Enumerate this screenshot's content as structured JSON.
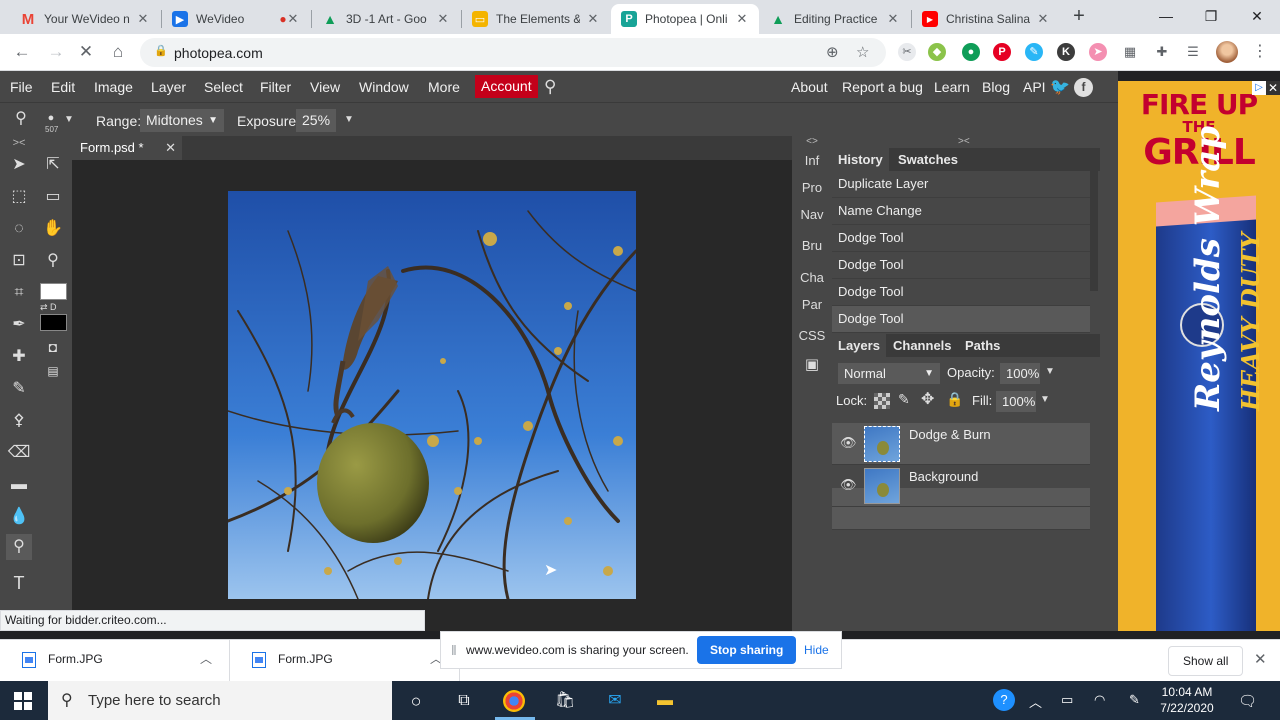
{
  "browser": {
    "tabs": [
      {
        "title": "Your WeVideo n",
        "icon": "gmail-icon",
        "color": "#ea4335"
      },
      {
        "title": "WeVideo",
        "icon": "wevideo-icon",
        "color": "#1a73e8"
      },
      {
        "title": "3D -1 Art - Goo",
        "icon": "drive-icon",
        "color": "#0f9d58"
      },
      {
        "title": "The Elements &",
        "icon": "slides-icon",
        "color": "#f4b400"
      },
      {
        "title": "Photopea | Onli",
        "icon": "photopea-icon",
        "color": "#18a497"
      },
      {
        "title": "Editing Practice",
        "icon": "drive-icon",
        "color": "#0f9d58"
      },
      {
        "title": "Christina Salina",
        "icon": "youtube-icon",
        "color": "#ff0000"
      }
    ],
    "url": "photopea.com"
  },
  "photopea": {
    "menu": [
      "File",
      "Edit",
      "Image",
      "Layer",
      "Select",
      "Filter",
      "View",
      "Window",
      "More"
    ],
    "account_label": "Account",
    "right_links": [
      "About",
      "Report a bug",
      "Learn",
      "Blog",
      "API"
    ],
    "options": {
      "brush_size": "507",
      "range_label": "Range:",
      "range_value": "Midtones",
      "exposure_label": "Exposure:",
      "exposure_value": "25%"
    },
    "document_tab": "Form.psd *",
    "side_tabs": [
      "Inf",
      "Pro",
      "Nav",
      "Bru",
      "Cha",
      "Par",
      "CSS"
    ],
    "history": {
      "tabs": [
        "History",
        "Swatches"
      ],
      "items": [
        "Duplicate Layer",
        "Name Change",
        "Dodge Tool",
        "Dodge Tool",
        "Dodge Tool",
        "Dodge Tool"
      ]
    },
    "layers": {
      "tabs": [
        "Layers",
        "Channels",
        "Paths"
      ],
      "blend_mode": "Normal",
      "opacity_label": "Opacity:",
      "opacity_value": "100%",
      "lock_label": "Lock:",
      "fill_label": "Fill:",
      "fill_value": "100%",
      "items": [
        {
          "name": "Dodge & Burn",
          "selected": true
        },
        {
          "name": "Background",
          "selected": false
        }
      ]
    }
  },
  "ad": {
    "line1": "FIRE UP",
    "line2": "THE",
    "line3": "GRILL",
    "brand": "Reynolds Wrap",
    "tagline": "HEAVY DUTY"
  },
  "status_text": "Waiting for bidder.criteo.com...",
  "share_bar": {
    "message": "www.wevideo.com is sharing your screen.",
    "stop_label": "Stop sharing",
    "hide_label": "Hide"
  },
  "downloads": {
    "items": [
      "Form.JPG",
      "Form.JPG"
    ],
    "show_all": "Show all"
  },
  "taskbar": {
    "search_placeholder": "Type here to search",
    "time": "10:04 AM",
    "date": "7/22/2020"
  }
}
